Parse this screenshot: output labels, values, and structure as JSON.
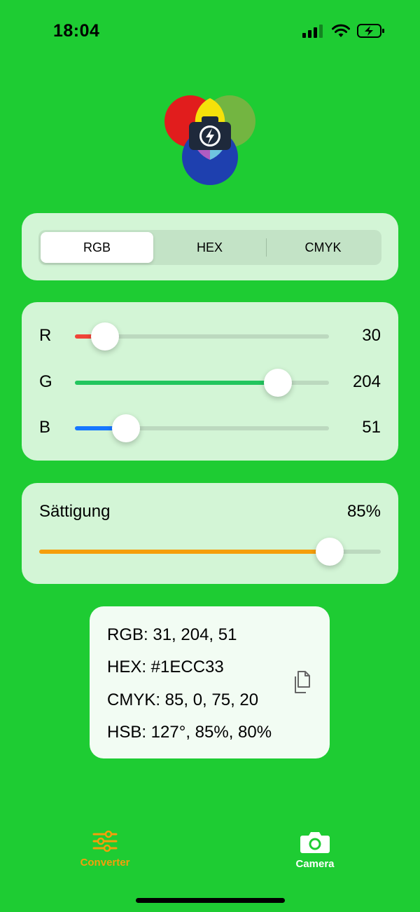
{
  "status_bar": {
    "time": "18:04",
    "icons": [
      "signal-icon",
      "wifi-icon",
      "battery-charging-icon"
    ]
  },
  "logo": {
    "icon": "rgb-camera-logo-icon"
  },
  "segmented": {
    "items": [
      {
        "label": "RGB",
        "selected": true
      },
      {
        "label": "HEX",
        "selected": false
      },
      {
        "label": "CMYK",
        "selected": false
      }
    ]
  },
  "sliders": [
    {
      "label": "R",
      "value": "30",
      "level": 30,
      "max": 255,
      "color": "#F04438"
    },
    {
      "label": "G",
      "value": "204",
      "level": 204,
      "max": 255,
      "color": "#22C55E"
    },
    {
      "label": "B",
      "value": "51",
      "level": 51,
      "max": 255,
      "color": "#1677FF"
    }
  ],
  "saturation": {
    "label": "Sättigung",
    "value": "85%",
    "level": 0.85,
    "color": "#F59E0B"
  },
  "result": {
    "rgb": "RGB: 31, 204, 51",
    "hex": "HEX: #1ECC33",
    "cmyk": "CMYK: 85, 0, 75, 20",
    "hsb": "HSB: 127°, 85%, 80%",
    "copy_icon": "copy-icon"
  },
  "tab_bar": {
    "converter": {
      "label": "Converter",
      "icon": "sliders-icon",
      "active": true
    },
    "camera": {
      "label": "Camera",
      "icon": "camera-icon",
      "active": false
    }
  },
  "colors": {
    "background": "#1ECC33",
    "card": "#D3F5D6",
    "accent": "#F59E0B"
  }
}
